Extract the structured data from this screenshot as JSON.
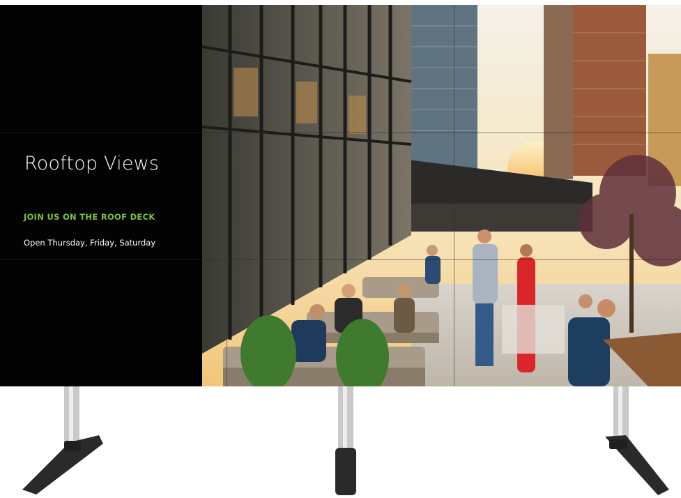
{
  "slide": {
    "title": "Rooftop Views",
    "tagline": "JOIN US ON THE ROOF DECK",
    "hours": "Open Thursday, Friday, Saturday"
  },
  "colors": {
    "tagline": "#7cc243",
    "panel": "#030303",
    "stand": "#2a2a2a",
    "pole": "#c9c9c9"
  },
  "photo": {
    "subject": "rooftop-terrace-with-skyline"
  },
  "stands": [
    "left",
    "center",
    "right"
  ]
}
